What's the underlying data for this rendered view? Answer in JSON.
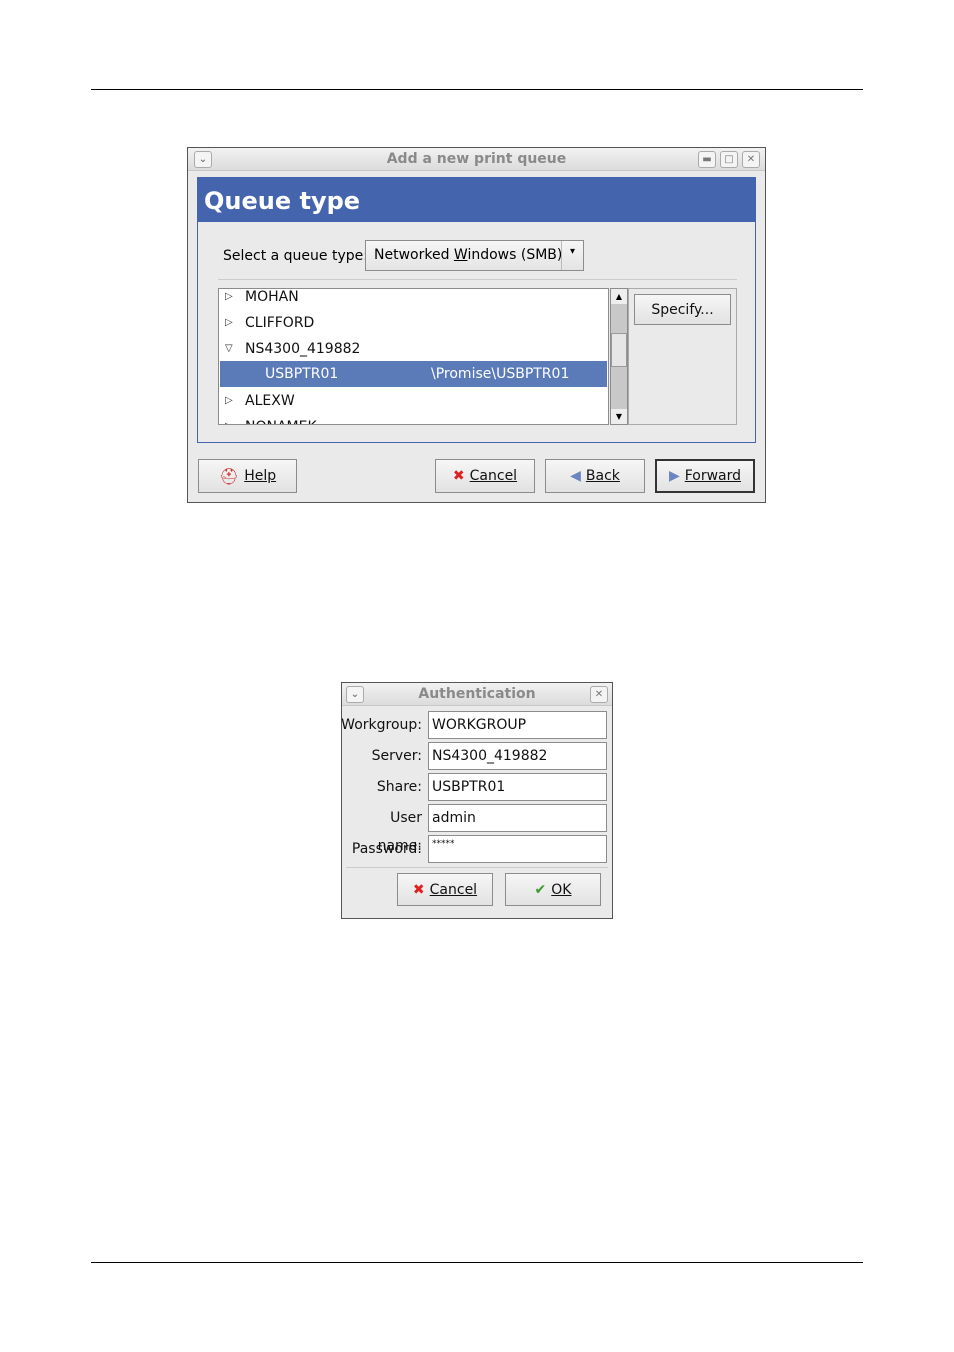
{
  "queue_dialog": {
    "title": "Add a new print queue",
    "header": "Queue type",
    "select_label": "Select a queue type:",
    "select_value_pre": "Networked ",
    "select_value_u": "W",
    "select_value_post": "indows (SMB)",
    "tree": [
      {
        "name": "MOHAN",
        "expanded": false
      },
      {
        "name": "CLIFFORD",
        "expanded": false
      },
      {
        "name": "NS4300_419882",
        "expanded": true
      },
      {
        "name": "USBPTR01",
        "path": "\\Promise\\USBPTR01",
        "selected": true,
        "child": true
      },
      {
        "name": "ALEXW",
        "expanded": false
      },
      {
        "name": "NONAMEK",
        "expanded": false
      }
    ],
    "specify_label": "Specify...",
    "buttons": {
      "help": "Help",
      "cancel": "Cancel",
      "back": "Back",
      "forward": "Forward"
    },
    "colors": {
      "header": "#4465ad",
      "selection": "#5a7ab8"
    }
  },
  "auth_dialog": {
    "title": "Authentication",
    "fields": [
      {
        "label": "Workgroup:",
        "value": "WORKGROUP"
      },
      {
        "label": "Server:",
        "value": "NS4300_419882"
      },
      {
        "label": "Share:",
        "value": "USBPTR01"
      },
      {
        "label": "User name:",
        "value": "admin"
      },
      {
        "label": "Password:",
        "value": "*****"
      }
    ],
    "buttons": {
      "cancel": "Cancel",
      "ok": "OK"
    }
  }
}
